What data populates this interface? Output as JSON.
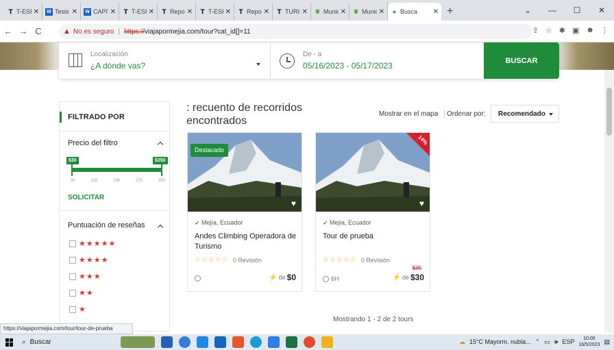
{
  "browser": {
    "tabs": [
      {
        "icon": "T",
        "title": "T-ESPE"
      },
      {
        "icon": "W",
        "title": "Tesis I"
      },
      {
        "icon": "W",
        "title": "CAPIT"
      },
      {
        "icon": "T",
        "title": "T-ESP"
      },
      {
        "icon": "T",
        "title": "Repos"
      },
      {
        "icon": "T",
        "title": "T-ESP"
      },
      {
        "icon": "T",
        "title": "Repos"
      },
      {
        "icon": "T",
        "title": "TURIS"
      },
      {
        "icon": "M",
        "title": "Munic"
      },
      {
        "icon": "M",
        "title": "Munic"
      },
      {
        "icon": "dot",
        "title": "Busca"
      }
    ],
    "new_tab": "+",
    "security_label": "No es seguro",
    "url_scheme": "https://",
    "url_rest": "viajapormejia.com/tour?cat_id[]=11",
    "status_url": "https://viajapormejia.com/tour/tour-de-prueba"
  },
  "search": {
    "location_label": "Localización",
    "location_placeholder": "¿A dónde vas?",
    "date_label": "De - a",
    "date_value": "05/16/2023 - 05/17/2023",
    "button": "BUSCAR"
  },
  "sidebar": {
    "title": "FILTRADO POR",
    "price_title": "Precio del filtro",
    "price_min": "$30",
    "price_max": "$350",
    "price_ticks": [
      "30",
      "110",
      "190",
      "270",
      "350"
    ],
    "apply": "SOLICITAR",
    "rating_title": "Puntuación de reseñas",
    "ratings": [
      "★★★★★",
      "★★★★",
      "★★★",
      "★★",
      "★"
    ]
  },
  "results": {
    "title": ": recuento de recorridos encontrados",
    "map_link": "Mostrar en el mapa",
    "order_label": "Ordenar por:",
    "order_value": "Recomendado",
    "showing": "Mostrando 1 - 2 de 2 tours"
  },
  "tours": [
    {
      "badge": "Destacado",
      "location": "Mejía, Ecuador",
      "name": "Andes Climbing Operadora de Turismo",
      "stars": "☆☆☆☆☆",
      "reviews": "0 Revisión",
      "duration": "",
      "price_prefix": "de",
      "price": "$0",
      "old_price": "",
      "discount": ""
    },
    {
      "badge": "",
      "location": "Mejía, Ecuador",
      "name": "Tour de prueba",
      "stars": "☆☆☆☆☆",
      "reviews": "0 Revisión",
      "duration": "6H",
      "price_prefix": "de",
      "price": "$30",
      "old_price": "$35",
      "discount": "14%"
    }
  ],
  "taskbar": {
    "search": "Buscar",
    "weather": "15°C  Mayorm. nubla...",
    "lang": "ESP",
    "time": "10:00",
    "date": "16/5/2023"
  },
  "colors": {
    "accent": "#1f8c3b",
    "sale": "#d4202e",
    "star": "#f2b01e"
  }
}
